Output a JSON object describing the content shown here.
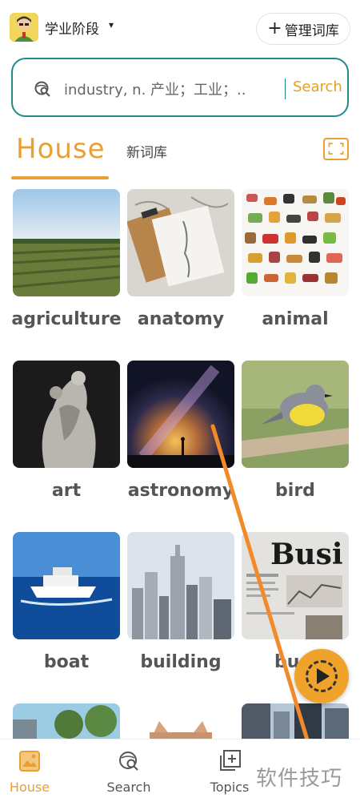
{
  "header": {
    "stage_label": "学业阶段",
    "stage_caret": "▾",
    "manage_label": "管理词库",
    "manage_plus": "+"
  },
  "search": {
    "text": "industry,       n. 产业；工业；..",
    "button_label": "Search"
  },
  "tabs": {
    "active": "House",
    "other": "新词库"
  },
  "grid": {
    "items": [
      {
        "label": "agriculture"
      },
      {
        "label": "anatomy"
      },
      {
        "label": "animal"
      },
      {
        "label": "art"
      },
      {
        "label": "astronomy"
      },
      {
        "label": "bird"
      },
      {
        "label": "boat"
      },
      {
        "label": "building"
      },
      {
        "label": "busi"
      },
      {
        "label": ""
      },
      {
        "label": ""
      },
      {
        "label": ""
      }
    ],
    "business_thumb_text": "Busi"
  },
  "bottom_nav": {
    "items": [
      {
        "label": "House",
        "icon": "image-icon",
        "active": true
      },
      {
        "label": "Search",
        "icon": "search-globe-icon",
        "active": false
      },
      {
        "label": "Topics",
        "icon": "add-box-icon",
        "active": false
      }
    ]
  },
  "watermark": "软件技巧",
  "colors": {
    "accent": "#e8a035",
    "search_border": "#1f8c88",
    "search_button": "#e4a21b"
  }
}
